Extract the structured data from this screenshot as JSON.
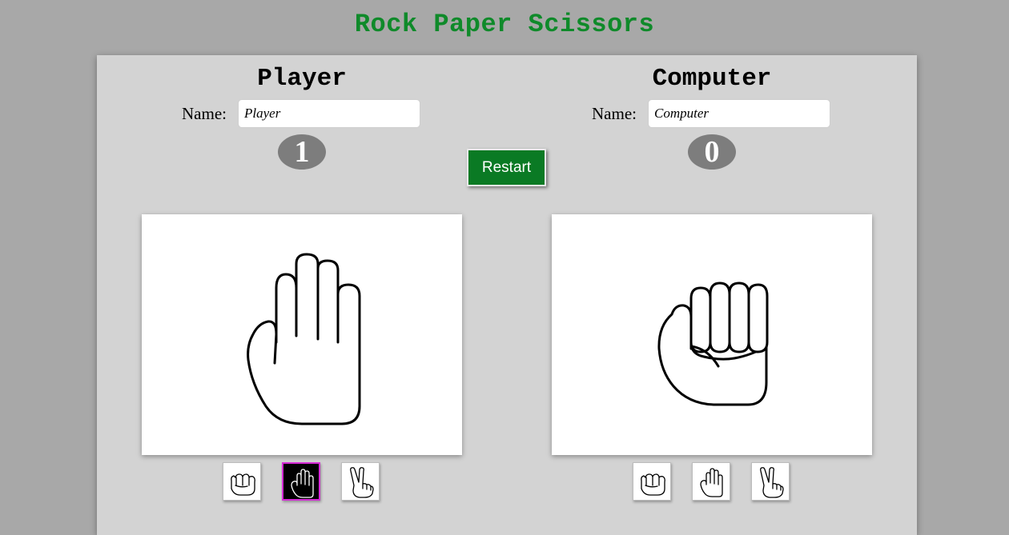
{
  "title": "Rock Paper Scissors",
  "restart_label": "Restart",
  "player": {
    "heading": "Player",
    "name_label": "Name:",
    "name_value": "Player",
    "score": "1",
    "current_choice": "paper",
    "selected_choice": "paper"
  },
  "computer": {
    "heading": "Computer",
    "name_label": "Name:",
    "name_value": "Computer",
    "score": "0",
    "current_choice": "rock",
    "selected_choice": "none"
  },
  "choices": [
    "rock",
    "paper",
    "scissors"
  ],
  "icons": {
    "rock": "rock-hand-icon",
    "paper": "paper-hand-icon",
    "scissors": "scissors-hand-icon"
  },
  "colors": {
    "title": "#0f8a2a",
    "restart_bg": "#0a7a24",
    "selected_border": "#d62ad6",
    "score_badge": "#7d7d7d"
  }
}
